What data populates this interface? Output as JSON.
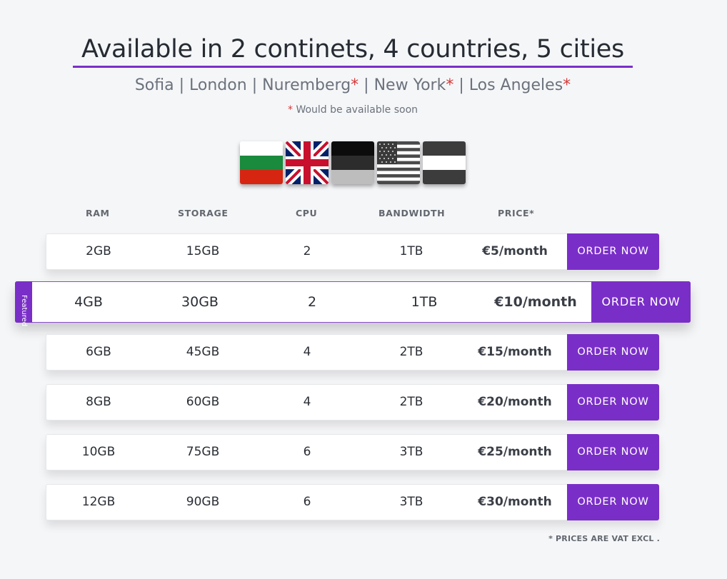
{
  "header": {
    "title": "Available in 2 continets, 4 countries, 5 cities",
    "cities": [
      {
        "name": "Sofia",
        "soon": false
      },
      {
        "name": "London",
        "soon": false
      },
      {
        "name": "Nuremberg",
        "soon": true
      },
      {
        "name": "New York",
        "soon": true
      },
      {
        "name": "Los Angeles",
        "soon": true
      }
    ],
    "separator": "|",
    "star": "*",
    "soon_note": "Would be available soon"
  },
  "flags": [
    {
      "icon": "bulgaria-flag-icon"
    },
    {
      "icon": "uk-flag-icon"
    },
    {
      "icon": "germany-flag-icon"
    },
    {
      "icon": "usa-flag-icon"
    },
    {
      "icon": "usa-flag-alt-icon"
    }
  ],
  "table": {
    "columns": [
      "RAM",
      "STORAGE",
      "CPU",
      "BANDWIDTH",
      "PRICE*"
    ],
    "order_label": "ORDER NOW",
    "featured_label": "Featured",
    "rows": [
      {
        "ram": "2GB",
        "storage": "15GB",
        "cpu": "2",
        "bandwidth": "1TB",
        "price": "€5/month",
        "featured": false
      },
      {
        "ram": "4GB",
        "storage": "30GB",
        "cpu": "2",
        "bandwidth": "1TB",
        "price": "€10/month",
        "featured": true
      },
      {
        "ram": "6GB",
        "storage": "45GB",
        "cpu": "4",
        "bandwidth": "2TB",
        "price": "€15/month",
        "featured": false
      },
      {
        "ram": "8GB",
        "storage": "60GB",
        "cpu": "4",
        "bandwidth": "2TB",
        "price": "€20/month",
        "featured": false
      },
      {
        "ram": "10GB",
        "storage": "75GB",
        "cpu": "6",
        "bandwidth": "3TB",
        "price": "€25/month",
        "featured": false
      },
      {
        "ram": "12GB",
        "storage": "90GB",
        "cpu": "6",
        "bandwidth": "3TB",
        "price": "€30/month",
        "featured": false
      }
    ]
  },
  "footer_note": "* PRICES ARE VAT EXCL .",
  "colors": {
    "accent": "#7a2ec8",
    "star": "#d33a3a",
    "background": "#f5f6f8"
  }
}
